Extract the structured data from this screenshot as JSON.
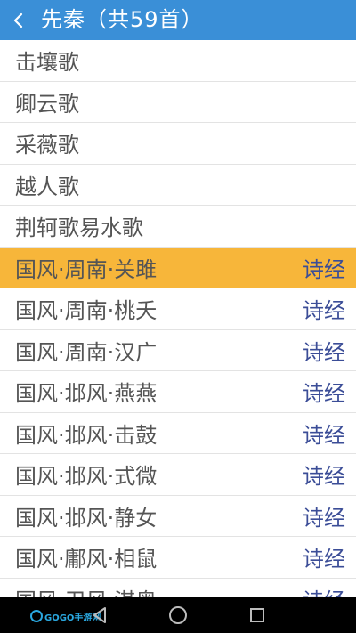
{
  "header": {
    "title": "先秦（共59首）"
  },
  "list": {
    "items": [
      {
        "title": "击壤歌",
        "source": ""
      },
      {
        "title": "卿云歌",
        "source": ""
      },
      {
        "title": "采薇歌",
        "source": ""
      },
      {
        "title": "越人歌",
        "source": ""
      },
      {
        "title": "荆轲歌易水歌",
        "source": ""
      },
      {
        "title": "国风·周南·关雎",
        "source": "诗经",
        "selected": true
      },
      {
        "title": "国风·周南·桃夭",
        "source": "诗经"
      },
      {
        "title": "国风·周南·汉广",
        "source": "诗经"
      },
      {
        "title": "国风·邶风·燕燕",
        "source": "诗经"
      },
      {
        "title": "国风·邶风·击鼓",
        "source": "诗经"
      },
      {
        "title": "国风·邶风·式微",
        "source": "诗经"
      },
      {
        "title": "国风·邶风·静女",
        "source": "诗经"
      },
      {
        "title": "国风·鄘风·相鼠",
        "source": "诗经"
      },
      {
        "title": "国风·卫风·淇奥",
        "source": "诗经"
      }
    ]
  },
  "watermark": {
    "text": "GOGO手游网"
  },
  "colors": {
    "header_bg": "#3a8fd7",
    "selected_bg": "#f7b63a",
    "source_text": "#3b4d97"
  }
}
